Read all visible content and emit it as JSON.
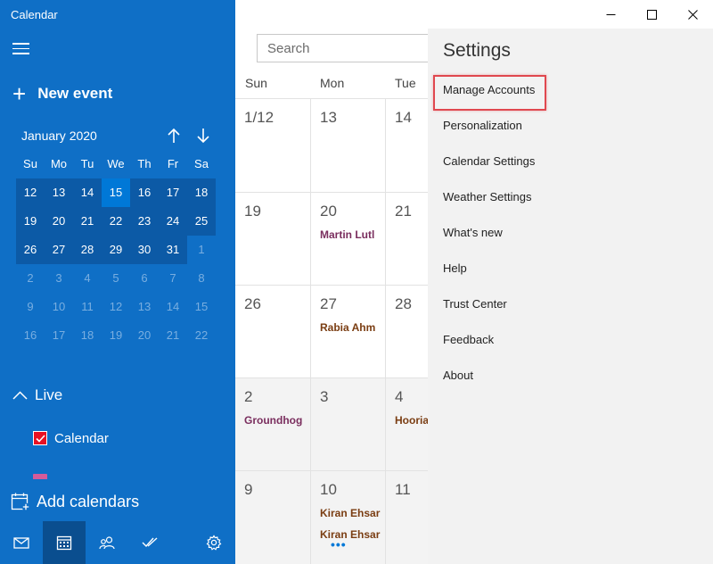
{
  "app": {
    "title": "Calendar"
  },
  "sidebar": {
    "new_event": "New event",
    "month_label": "January 2020",
    "weekday_headers": [
      "Su",
      "Mo",
      "Tu",
      "We",
      "Th",
      "Fr",
      "Sa"
    ],
    "mini_calendar": [
      [
        {
          "d": "12",
          "s": "cur"
        },
        {
          "d": "13",
          "s": "cur"
        },
        {
          "d": "14",
          "s": "cur"
        },
        {
          "d": "15",
          "s": "today"
        },
        {
          "d": "16",
          "s": "cur"
        },
        {
          "d": "17",
          "s": "cur"
        },
        {
          "d": "18",
          "s": "cur"
        }
      ],
      [
        {
          "d": "19",
          "s": "cur"
        },
        {
          "d": "20",
          "s": "cur"
        },
        {
          "d": "21",
          "s": "cur"
        },
        {
          "d": "22",
          "s": "cur"
        },
        {
          "d": "23",
          "s": "cur"
        },
        {
          "d": "24",
          "s": "cur"
        },
        {
          "d": "25",
          "s": "cur"
        }
      ],
      [
        {
          "d": "26",
          "s": "cur"
        },
        {
          "d": "27",
          "s": "cur"
        },
        {
          "d": "28",
          "s": "cur"
        },
        {
          "d": "29",
          "s": "cur"
        },
        {
          "d": "30",
          "s": "cur"
        },
        {
          "d": "31",
          "s": "cur"
        },
        {
          "d": "1",
          "s": "dim"
        }
      ],
      [
        {
          "d": "2",
          "s": "dim"
        },
        {
          "d": "3",
          "s": "dim"
        },
        {
          "d": "4",
          "s": "dim"
        },
        {
          "d": "5",
          "s": "dim"
        },
        {
          "d": "6",
          "s": "dim"
        },
        {
          "d": "7",
          "s": "dim"
        },
        {
          "d": "8",
          "s": "dim"
        }
      ],
      [
        {
          "d": "9",
          "s": "dim"
        },
        {
          "d": "10",
          "s": "dim"
        },
        {
          "d": "11",
          "s": "dim"
        },
        {
          "d": "12",
          "s": "dim"
        },
        {
          "d": "13",
          "s": "dim"
        },
        {
          "d": "14",
          "s": "dim"
        },
        {
          "d": "15",
          "s": "dim"
        }
      ],
      [
        {
          "d": "16",
          "s": "dim"
        },
        {
          "d": "17",
          "s": "dim"
        },
        {
          "d": "18",
          "s": "dim"
        },
        {
          "d": "19",
          "s": "dim"
        },
        {
          "d": "20",
          "s": "dim"
        },
        {
          "d": "21",
          "s": "dim"
        },
        {
          "d": "22",
          "s": "dim"
        }
      ]
    ],
    "live_label": "Live",
    "calendar_item": "Calendar",
    "add_calendars": "Add calendars",
    "bottom_icons": [
      "mail-icon",
      "calendar-icon",
      "people-icon",
      "todo-icon",
      "settings-icon"
    ]
  },
  "search": {
    "placeholder": "Search"
  },
  "week_view": {
    "day_headers": [
      "Sun",
      "Mon",
      "Tue"
    ],
    "rows": [
      {
        "cells": [
          {
            "num": "1/12",
            "events": []
          },
          {
            "num": "13",
            "events": []
          },
          {
            "num": "14",
            "events": []
          }
        ]
      },
      {
        "cells": [
          {
            "num": "19",
            "events": []
          },
          {
            "num": "20",
            "events": [
              {
                "text": "Martin Lutl",
                "color": "purple"
              }
            ]
          },
          {
            "num": "21",
            "events": []
          }
        ]
      },
      {
        "cells": [
          {
            "num": "26",
            "events": []
          },
          {
            "num": "27",
            "events": [
              {
                "text": "Rabia Ahm",
                "color": "brown"
              }
            ]
          },
          {
            "num": "28",
            "events": []
          }
        ]
      },
      {
        "cells": [
          {
            "num": "2",
            "events": [
              {
                "text": "Groundhog",
                "color": "purple"
              }
            ]
          },
          {
            "num": "3",
            "events": []
          },
          {
            "num": "4",
            "events": [
              {
                "text": "Hooria",
                "color": "brown"
              }
            ]
          }
        ]
      },
      {
        "cells": [
          {
            "num": "9",
            "events": []
          },
          {
            "num": "10",
            "events": [
              {
                "text": "Kiran Ehsar",
                "color": "brown"
              },
              {
                "text": "Kiran Ehsar",
                "color": "brown"
              }
            ],
            "more": "•••"
          },
          {
            "num": "11",
            "events": []
          }
        ]
      }
    ]
  },
  "settings": {
    "title": "Settings",
    "items": [
      "Manage Accounts",
      "Personalization",
      "Calendar Settings",
      "Weather Settings",
      "What's new",
      "Help",
      "Trust Center",
      "Feedback",
      "About"
    ]
  },
  "colors": {
    "sidebar_bg": "#0f6fc6",
    "today": "#0078d7",
    "highlight_border": "#e0484f",
    "calendar_checkbox": "#e81123"
  }
}
